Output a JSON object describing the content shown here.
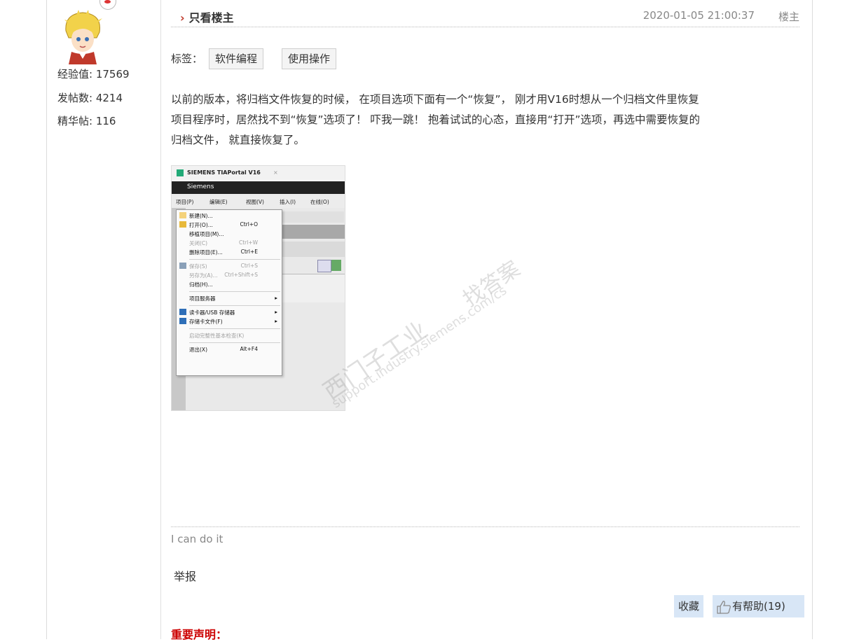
{
  "user": {
    "stats": [
      {
        "label": "经验值: 17569"
      },
      {
        "label": "发帖数: 4214"
      },
      {
        "label": "精华帖: 116"
      }
    ]
  },
  "post": {
    "only_op_label": "只看楼主",
    "timestamp": "2020-01-05 21:00:37",
    "floor_label": "楼主",
    "tags_label": "标签：",
    "tags": [
      "软件编程",
      "使用操作"
    ],
    "body_lines": [
      "以前的版本，将归档文件恢复的时候， 在项目选项下面有一个“恢复”， 刚才用V16时想从一个归档文件里恢复",
      "项目程序时，居然找不到“恢复”选项了！ 吓我一跳！ 抱着试试的心态，直接用“打开”选项，再选中需要恢复的",
      "归档文件， 就直接恢复了。"
    ],
    "signature": "I can do it",
    "report_label": "举报",
    "favorite_label": "收藏",
    "helpful_label": "有帮助(19)",
    "notice_title": "重要声明："
  },
  "screenshot": {
    "tab_title": "SIEMENS TIAPortal V16",
    "tab_close": "×",
    "window_title": "Siemens",
    "menubar": [
      "项目(P)",
      "编辑(E)",
      "视图(V)",
      "插入(I)",
      "在线(O)"
    ],
    "menu_items": [
      {
        "label": "新建(N)...",
        "shortcut": "",
        "disabled": false
      },
      {
        "label": "打开(O)...",
        "shortcut": "Ctrl+O",
        "disabled": false
      },
      {
        "label": "移植项目(M)...",
        "shortcut": "",
        "disabled": false
      },
      {
        "label": "关闭(C)",
        "shortcut": "Ctrl+W",
        "disabled": true
      },
      {
        "label": "删除项目(E)...",
        "shortcut": "Ctrl+E",
        "disabled": false
      },
      {
        "label": "保存(S)",
        "shortcut": "Ctrl+S",
        "disabled": true
      },
      {
        "label": "另存为(A)...",
        "shortcut": "Ctrl+Shift+S",
        "disabled": true
      },
      {
        "label": "归档(H)...",
        "shortcut": "",
        "disabled": false
      },
      {
        "label": "项目服务器",
        "shortcut": "▸",
        "disabled": false
      },
      {
        "label": "读卡器/USB 存储器",
        "shortcut": "▸",
        "disabled": false
      },
      {
        "label": "存储卡文件(F)",
        "shortcut": "▸",
        "disabled": false
      },
      {
        "label": "启动完整性基本检查(K)",
        "shortcut": "",
        "disabled": true
      },
      {
        "label": "退出(X)",
        "shortcut": "Alt+F4",
        "disabled": false
      }
    ],
    "watermark_lines": [
      "西门子工业",
      "找答案",
      "support.industry.siemens.com/cs"
    ]
  },
  "colors": {
    "accent_red": "#c00000",
    "button_bg": "#d8e6f6",
    "meta_gray": "#888888"
  }
}
